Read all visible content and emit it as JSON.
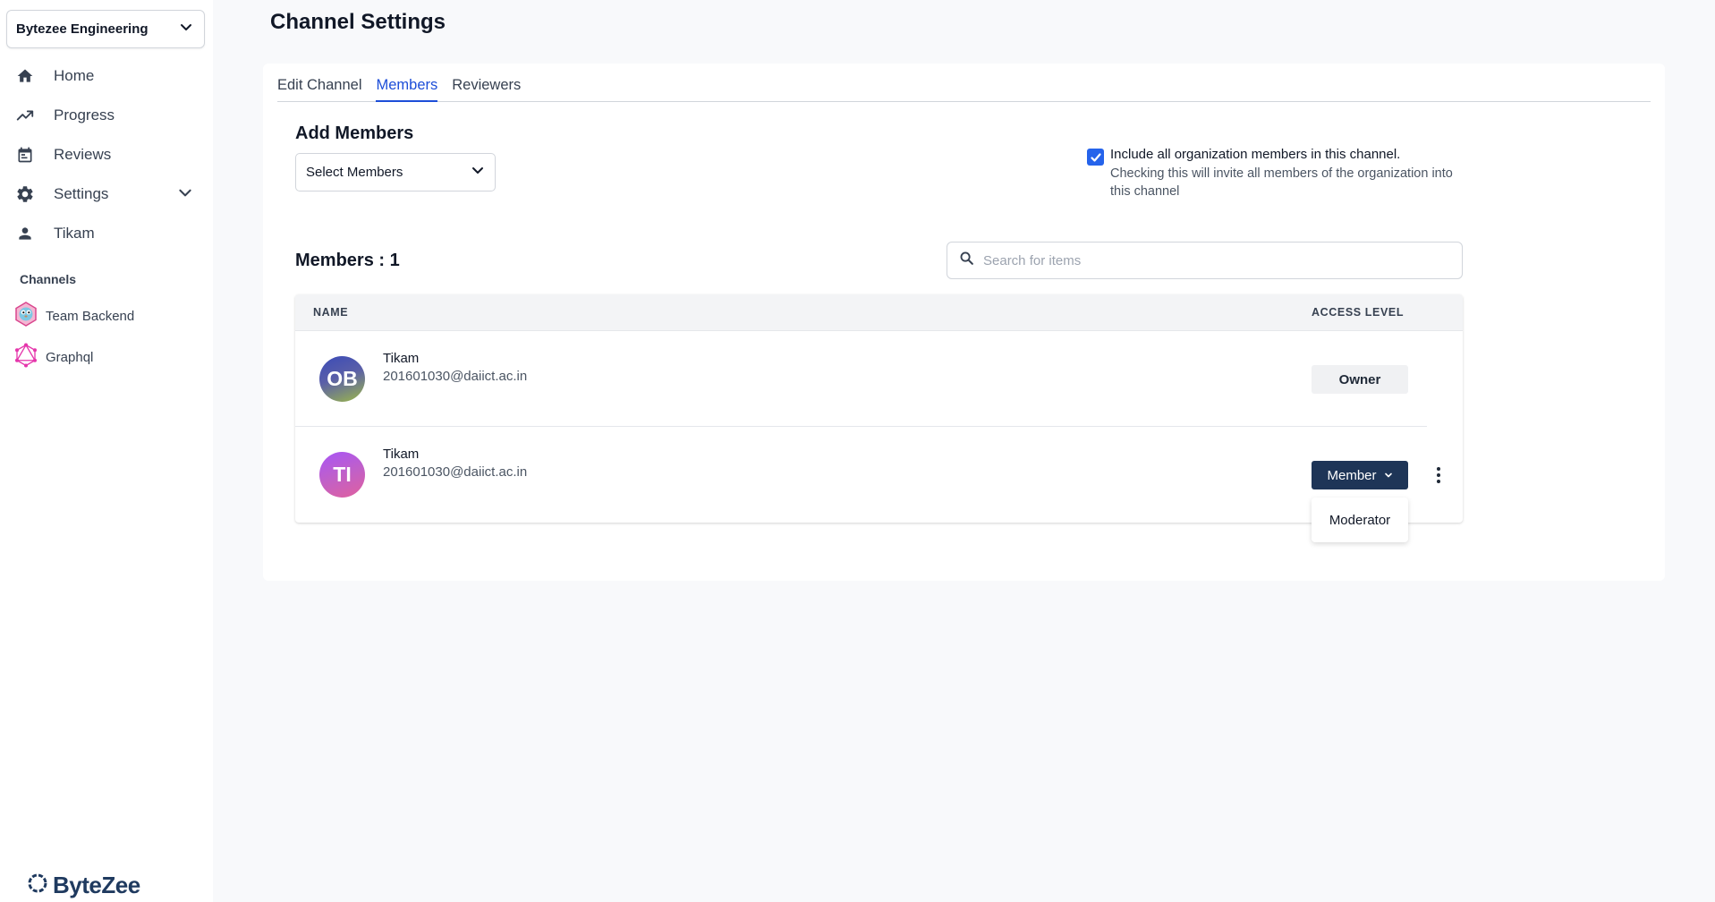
{
  "sidebar": {
    "org_name": "Bytezee Engineering",
    "nav": [
      {
        "label": "Home",
        "icon": "home-icon"
      },
      {
        "label": "Progress",
        "icon": "trending-up-icon"
      },
      {
        "label": "Reviews",
        "icon": "calendar-icon"
      },
      {
        "label": "Settings",
        "icon": "gear-icon"
      },
      {
        "label": "Tikam",
        "icon": "person-icon"
      }
    ],
    "channels_title": "Channels",
    "channels": [
      {
        "label": "Team Backend",
        "icon": "gopher-icon"
      },
      {
        "label": "Graphql",
        "icon": "graphql-icon"
      }
    ],
    "brand": "ByteZee"
  },
  "page": {
    "title": "Channel Settings"
  },
  "tabs": [
    {
      "label": "Edit Channel",
      "active": false
    },
    {
      "label": "Members",
      "active": true
    },
    {
      "label": "Reviewers",
      "active": false
    }
  ],
  "add_members": {
    "title": "Add Members",
    "select_placeholder": "Select Members",
    "include_checked": true,
    "include_label": "Include all organization members in this channel.",
    "include_help": "Checking this will invite all members of the organization into this channel"
  },
  "members": {
    "count_label": "Members : 1",
    "search_placeholder": "Search for items",
    "columns": {
      "name": "NAME",
      "access": "ACCESS LEVEL"
    },
    "rows": [
      {
        "initials": "OB",
        "name": "Tikam",
        "email": "201601030@daiict.ac.in",
        "access": "Owner"
      },
      {
        "initials": "TI",
        "name": "Tikam",
        "email": "201601030@daiict.ac.in",
        "access": "Member"
      }
    ],
    "dropdown_option": "Moderator"
  },
  "colors": {
    "accent": "#1d4ed8",
    "member_button": "#1e3557",
    "checkbox": "#2563eb"
  }
}
